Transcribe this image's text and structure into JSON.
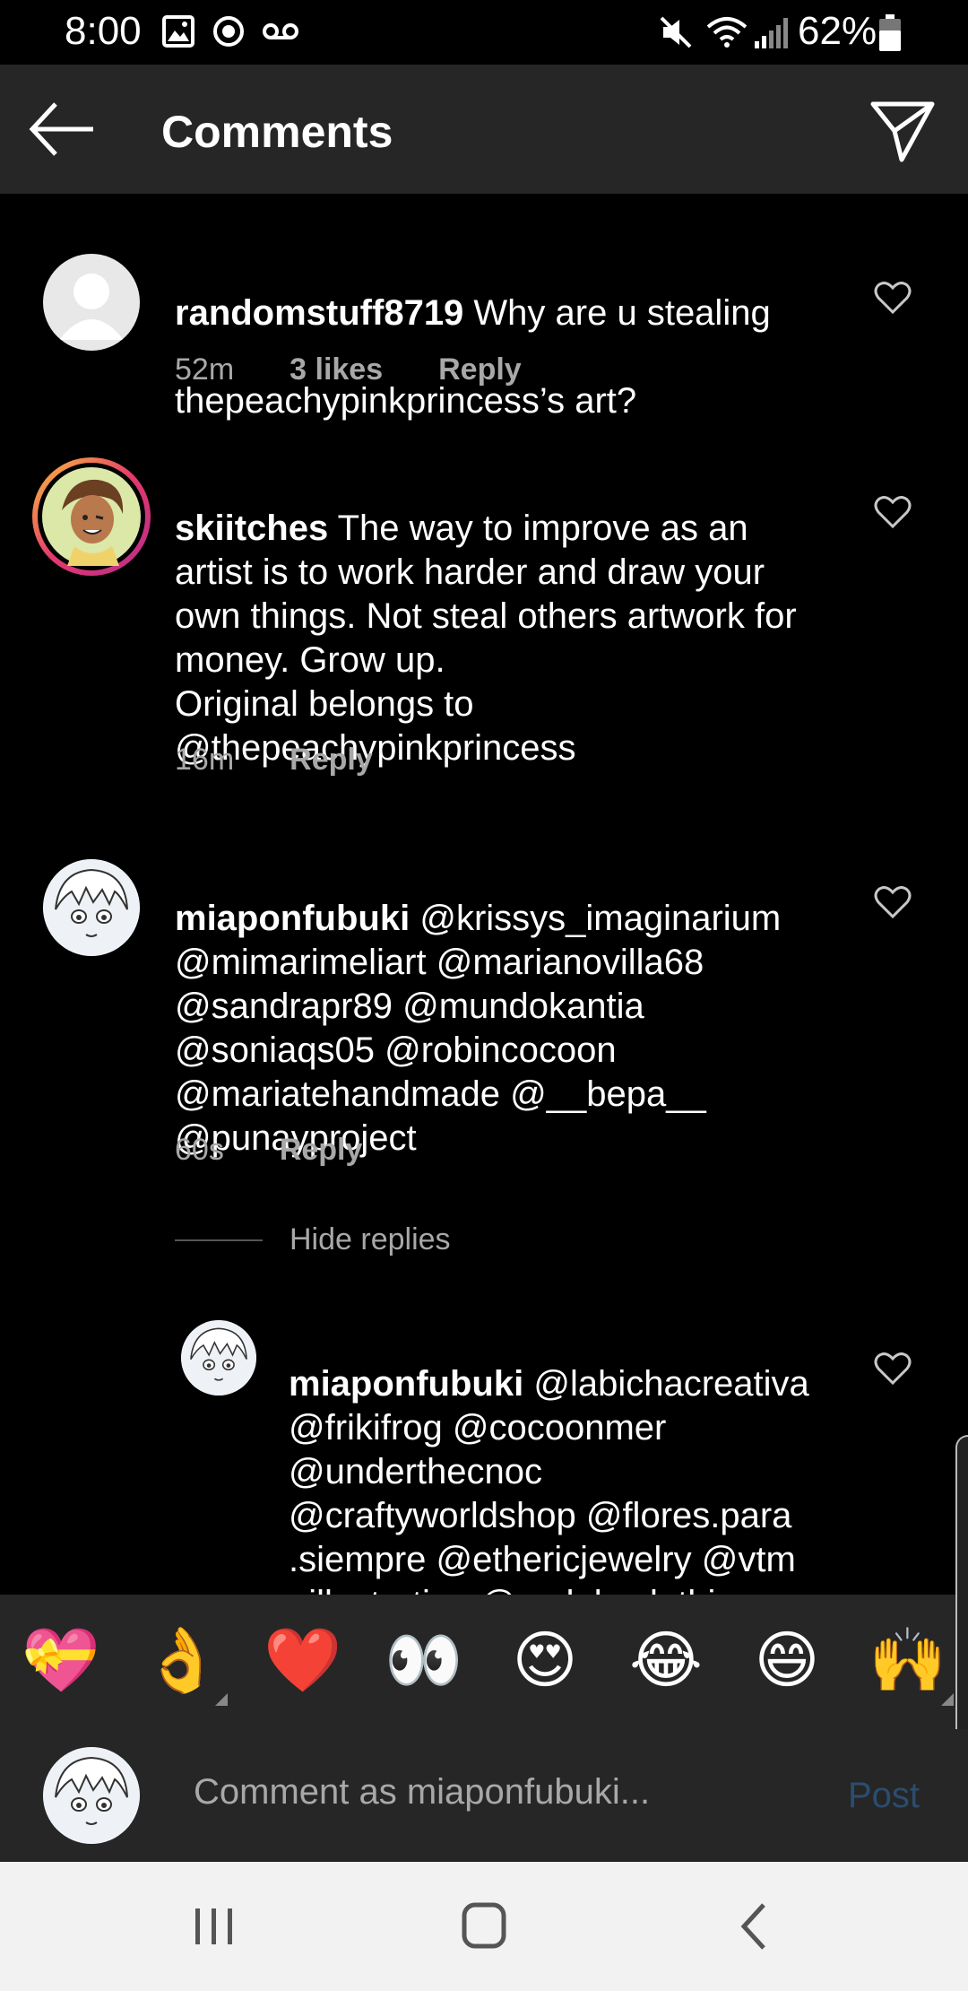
{
  "status_bar": {
    "time": "8:00",
    "battery": "62%"
  },
  "header": {
    "title": "Comments"
  },
  "comments": [
    {
      "username": "randomstuff8719",
      "text": "Why are u stealing thepeachypinkprincess’s art?",
      "line1_rest": " Why are u stealing",
      "line2": "thepeachypinkprincess’s art?",
      "time": "52m",
      "likes": "3 likes",
      "reply": "Reply"
    },
    {
      "username": "skiitches",
      "line1_rest": " The way to improve as an",
      "body": "artist is to work harder and draw your\nown things. Not steal others artwork for\nmoney. Grow up.\nOriginal belongs to\n@thepeachypinkprincess",
      "time": "16m",
      "reply": "Reply"
    },
    {
      "username": "miaponfubuki",
      "line1_rest": " @krissys_imaginarium",
      "body": "@mimarimeliart @marianovilla68\n@sandrapr89 @mundokantia\n@soniaqs05 @robincocoon\n@mariatehandmade @__bepa__\n@punayproject",
      "time": "60s",
      "reply": "Reply"
    }
  ],
  "hide_replies": "Hide replies",
  "reply_comment": {
    "username": "miaponfubuki",
    "line1_rest": " @labichacreativa",
    "body": "@frikifrog @cocoonmer\n@underthecnoc\n@craftyworldshop @flores.para\n.siempre @ethericjewelry @vtm\n_illustration @vrolok_clothing"
  },
  "emoji_bar": [
    "💝",
    "👌",
    "❤️",
    "👀",
    "😍",
    "😂",
    "😄",
    "🙌"
  ],
  "comment_input": {
    "placeholder": "Comment as miaponfubuki...",
    "post_label": "Post"
  },
  "colors": {
    "background": "#000000",
    "bar": "#262626",
    "muted_text": "#a8a8a8",
    "post_disabled": "#2b4d6e"
  }
}
